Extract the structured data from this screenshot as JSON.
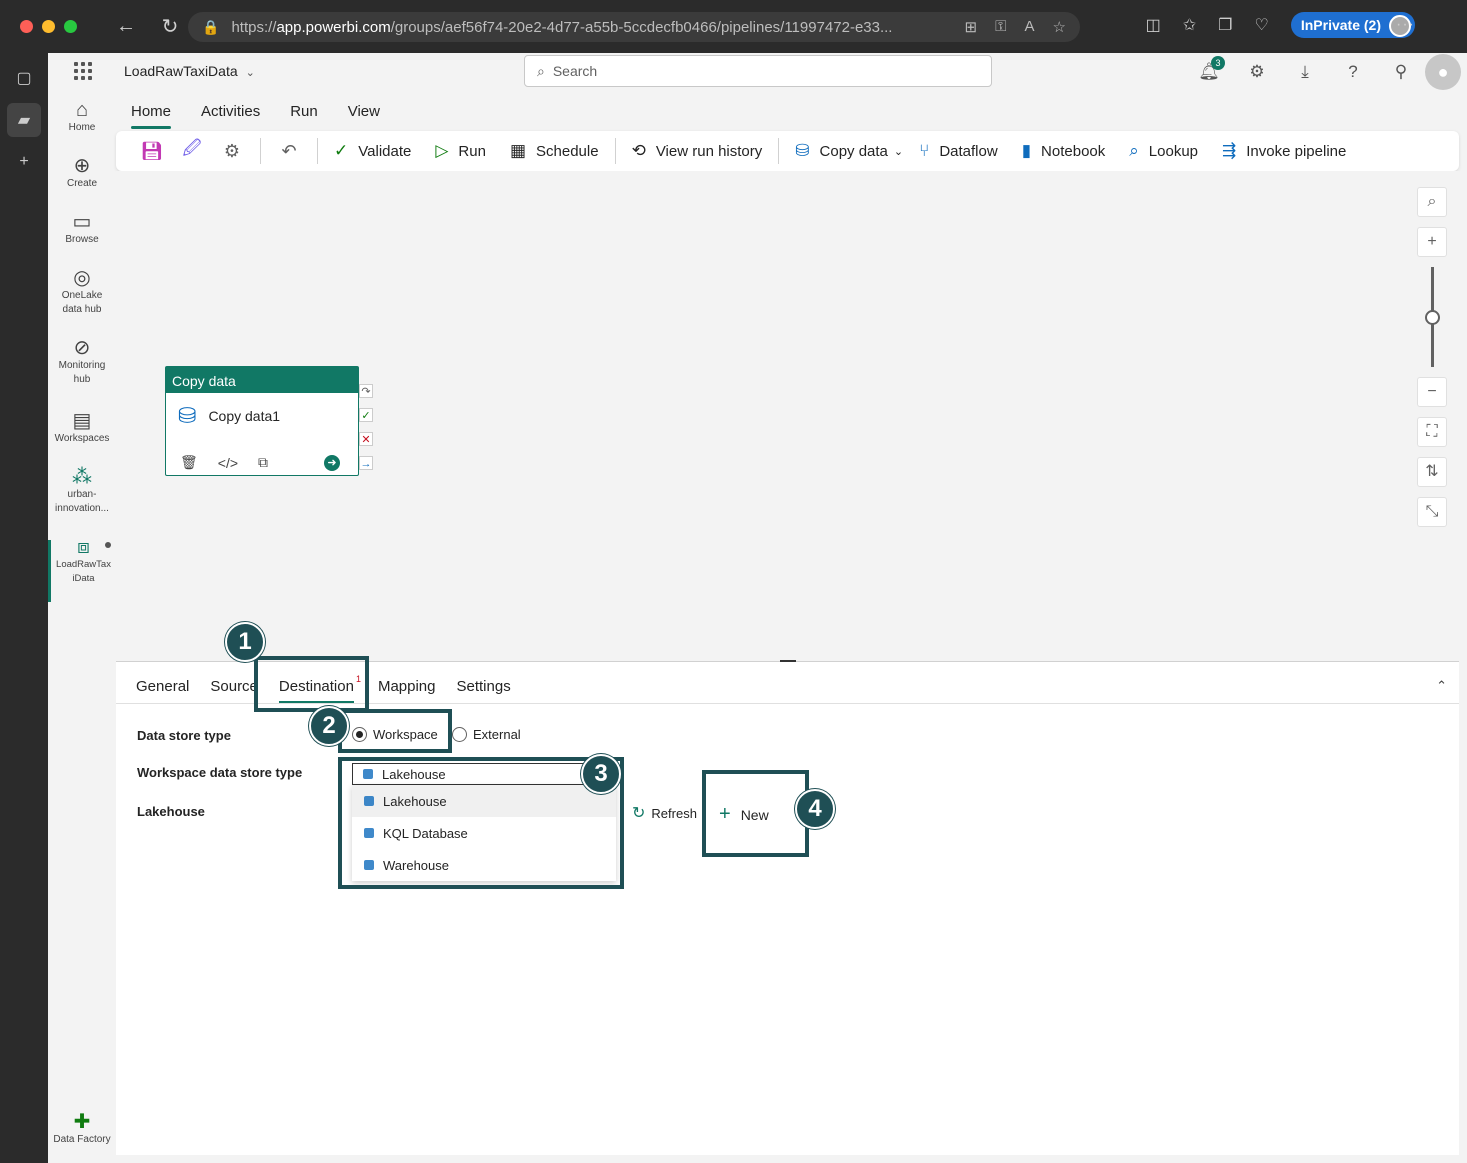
{
  "browser": {
    "url_prefix": "https://",
    "url_host": "app.powerbi.com",
    "url_path": "/groups/aef56f74-20e2-4d77-a55b-5ccdecfb0466/pipelines/11997472-e33...",
    "inprivate_label": "InPrivate (2)"
  },
  "header": {
    "app_title": "LoadRawTaxiData",
    "search_placeholder": "Search",
    "notification_count": "3"
  },
  "leftnav": [
    {
      "label": "Home",
      "icon": "home-icon"
    },
    {
      "label": "Create",
      "icon": "plus-circle-icon"
    },
    {
      "label": "Browse",
      "icon": "folder-icon"
    },
    {
      "label": "OneLake data hub",
      "icon": "onelake-icon"
    },
    {
      "label": "Monitoring hub",
      "icon": "monitor-icon"
    },
    {
      "label": "Workspaces",
      "icon": "workspaces-icon"
    },
    {
      "label": "urban-innovation...",
      "icon": "workspace-group-icon"
    },
    {
      "label": "LoadRawTaxiData",
      "icon": "pipeline-icon"
    }
  ],
  "footer_nav": {
    "label": "Data Factory"
  },
  "ribbon": {
    "tabs": [
      "Home",
      "Activities",
      "Run",
      "View"
    ],
    "active_tab": "Home",
    "buttons": {
      "validate": "Validate",
      "run": "Run",
      "schedule": "Schedule",
      "view_run_history": "View run history",
      "copy_data": "Copy data",
      "dataflow": "Dataflow",
      "notebook": "Notebook",
      "lookup": "Lookup",
      "invoke_pipeline": "Invoke pipeline"
    }
  },
  "canvas": {
    "activity_type": "Copy data",
    "activity_name": "Copy data1"
  },
  "panel": {
    "tabs": [
      "General",
      "Source",
      "Destination",
      "Mapping",
      "Settings"
    ],
    "active_tab": "Destination",
    "destination_badge": "1",
    "fields": {
      "data_store_type_label": "Data store type",
      "workspace_option": "Workspace",
      "external_option": "External",
      "selected_store_type": "Workspace",
      "workspace_store_type_label": "Workspace data store type",
      "workspace_store_type_value": "Lakehouse",
      "lakehouse_label": "Lakehouse"
    },
    "dropdown_options": [
      "Lakehouse",
      "KQL Database",
      "Warehouse"
    ],
    "refresh_label": "Refresh",
    "new_label": "New"
  },
  "callouts": [
    "1",
    "2",
    "3",
    "4"
  ],
  "colors": {
    "accent": "#117865",
    "callout": "#1f4f55"
  }
}
